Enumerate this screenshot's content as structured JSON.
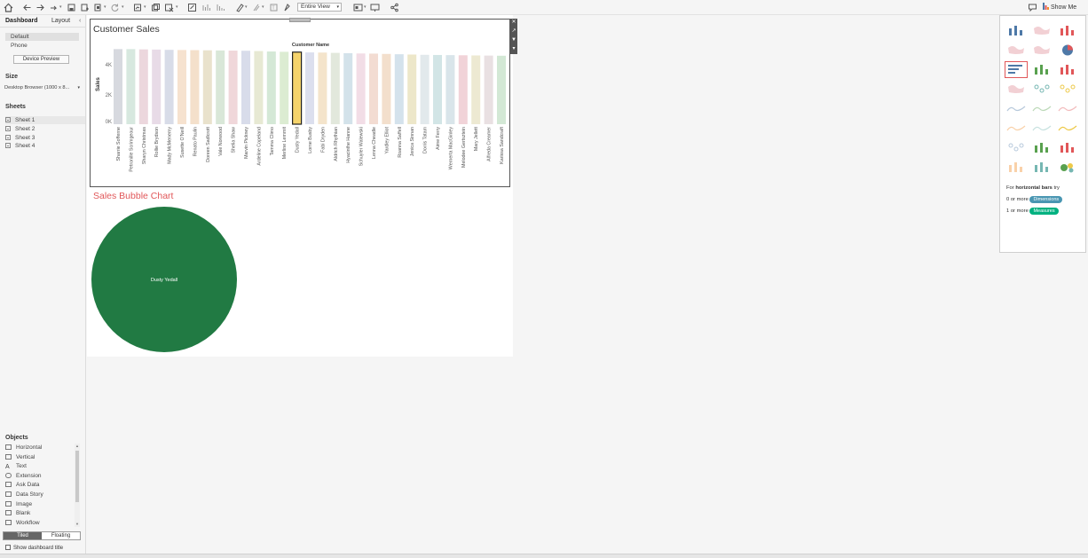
{
  "toolbar": {
    "fit_value": "Entire View",
    "show_me_label": "Show Me",
    "icons": [
      "home-icon",
      "undo-icon",
      "redo-icon",
      "pause-updates-icon",
      "save-icon",
      "new-datasource-icon",
      "new-worksheet-icon",
      "refresh-icon",
      "new-sheet-icon",
      "duplicate-icon",
      "clear-icon",
      "swap-icon",
      "sort-asc-icon",
      "sort-desc-icon",
      "highlight-icon",
      "group-icon",
      "label-icon",
      "fix-axes-icon",
      "fit-icon",
      "presentation-icon",
      "share-icon",
      "comment-icon"
    ]
  },
  "left_panel": {
    "tabs": [
      {
        "label": "Dashboard"
      },
      {
        "label": "Layout"
      }
    ],
    "collapse": "‹",
    "devices": [
      {
        "label": "Default"
      },
      {
        "label": "Phone"
      }
    ],
    "device_preview": "Device Preview",
    "size_title": "Size",
    "size_value": "Desktop Browser (1000 x 8...",
    "sheets_title": "Sheets",
    "sheets": [
      {
        "label": "Sheet 1"
      },
      {
        "label": "Sheet 2"
      },
      {
        "label": "Sheet 3"
      },
      {
        "label": "Sheet 4"
      }
    ],
    "objects_title": "Objects",
    "objects": [
      {
        "label": "Horizontal"
      },
      {
        "label": "Vertical"
      },
      {
        "label": "Text"
      },
      {
        "label": "Extension"
      },
      {
        "label": "Ask Data"
      },
      {
        "label": "Data Story"
      },
      {
        "label": "Image"
      },
      {
        "label": "Blank"
      },
      {
        "label": "Workflow"
      }
    ],
    "tiled": "Tiled",
    "floating": "Floating",
    "show_dashboard_title": "Show dashboard title"
  },
  "customer_sales": {
    "title": "Customer Sales",
    "column_header": "Customer Name",
    "y_axis_label": "Sales",
    "y_ticks": [
      "4K",
      "2K",
      "0K"
    ],
    "highlighted_customer": "Dusty Yedall"
  },
  "bubble_chart": {
    "title": "Sales Bubble Chart",
    "bubble_label": "Dusty Yedall",
    "bubble_color": "#217a43"
  },
  "show_me": {
    "hint_prefix": "For",
    "hint_type": "horizontal bars",
    "hint_suffix": "try",
    "dim_prefix": "0 or more",
    "dim_label": "Dimensions",
    "mea_prefix": "1 or more",
    "mea_label": "Measures",
    "chart_types": [
      "text-table",
      "heat-map",
      "highlight-table",
      "symbol-map",
      "filled-map",
      "pie-chart",
      "horizontal-bars",
      "stacked-bars",
      "side-by-side-bars",
      "treemap",
      "circle-views",
      "side-by-side-circles",
      "continuous-lines",
      "discrete-lines",
      "dual-lines",
      "continuous-area",
      "discrete-area",
      "dual-combination",
      "scatter-plot",
      "histogram",
      "box-and-whisker",
      "gantt-chart",
      "bullet-graph",
      "packed-bubbles"
    ]
  },
  "chart_data": {
    "type": "bar",
    "title": "Customer Sales",
    "xlabel": "Customer Name",
    "ylabel": "Sales",
    "ylim": [
      0,
      5000
    ],
    "y_ticks": [
      "4K",
      "2K",
      "0K"
    ],
    "categories": [
      "Sharrie Sofferne",
      "Petronille Scrimgeour",
      "Sharyn Christmas",
      "Rollie Brydson",
      "Mady McMenemy",
      "Susette O'Neill",
      "Renato Paulin",
      "Doreen Sadlcrott",
      "Vale Norwood",
      "Shelia Shaw",
      "Marvin Pickney",
      "Ardeline Copeland",
      "Tamma Climo",
      "Merline Lemmit",
      "Dusty Yedall",
      "Lorne Busby",
      "Fabi Dryden",
      "Aldrich Rhythian",
      "Hyacinthe Hanne",
      "Schuyler Walewski",
      "Lenna Cheadle",
      "Yardley Elliot",
      "Roanna Saffell",
      "Jenica Sinnan",
      "Dorris Tatam",
      "Aime Ferry",
      "Wernerta MacGinley",
      "Melodee Gertsztein",
      "Mary Jellett",
      "Alfreda Creamer",
      "Karissa Sandcraft"
    ],
    "values": [
      4980,
      4980,
      4960,
      4950,
      4930,
      4920,
      4910,
      4900,
      4890,
      4880,
      4870,
      4850,
      4820,
      4800,
      4780,
      4760,
      4750,
      4730,
      4710,
      4690,
      4680,
      4660,
      4640,
      4620,
      4600,
      4590,
      4580,
      4570,
      4560,
      4550,
      4540
    ],
    "highlighted": "Dusty Yedall"
  }
}
